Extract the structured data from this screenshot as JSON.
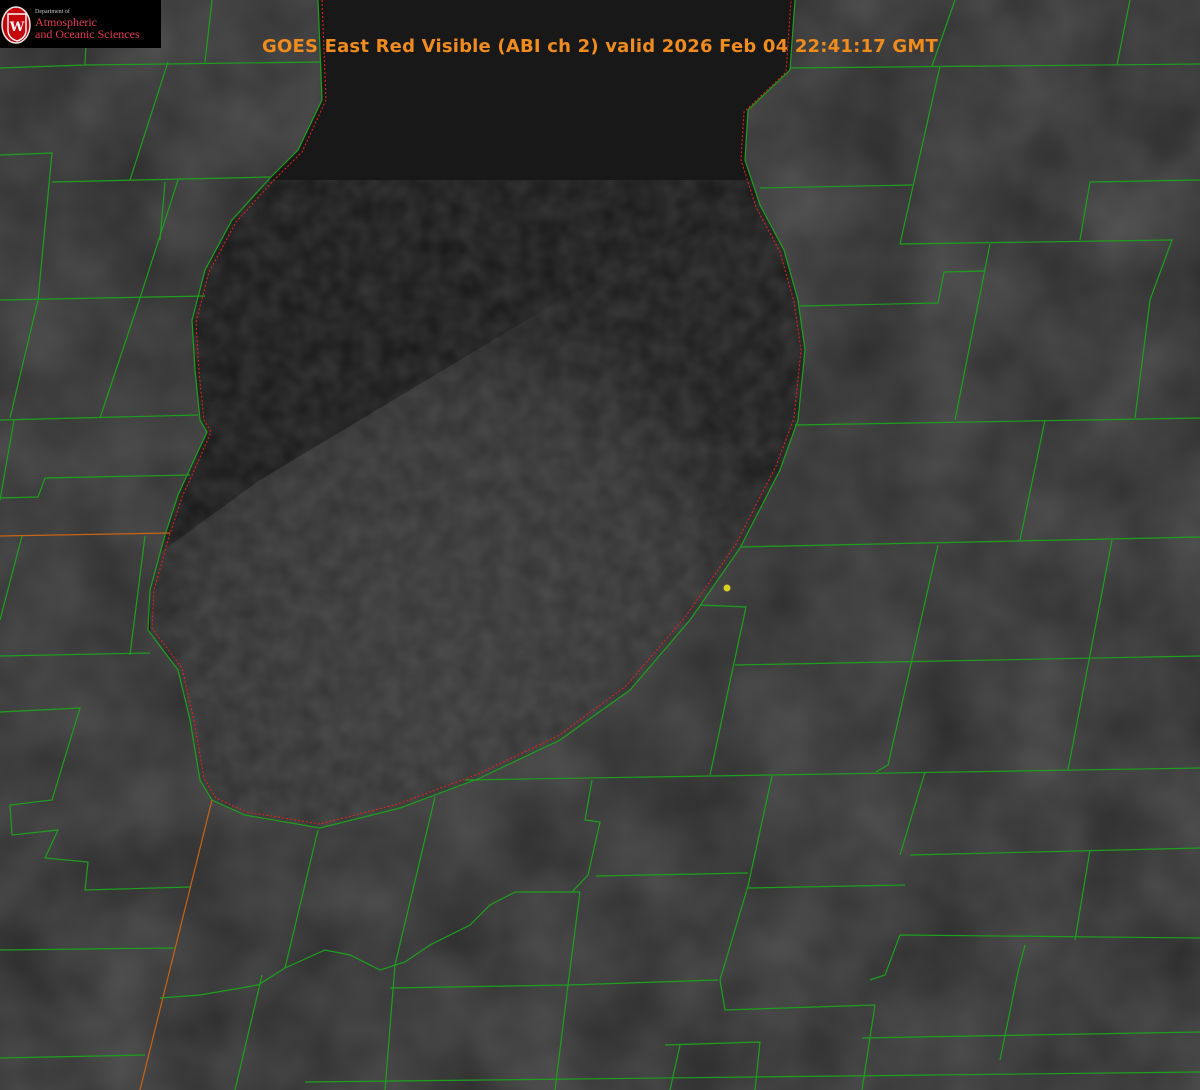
{
  "title": {
    "text": "GOES East Red Visible (ABI ch 2) valid 2026 Feb 04 22:41:17 GMT",
    "color": "#f08c1e"
  },
  "logo": {
    "department": "Department of",
    "line1": "Atmospheric",
    "line2": "and Oceanic Sciences",
    "shield_letter": "W",
    "accent_color": "#c5050c",
    "text_color": "#e43a4f"
  },
  "map": {
    "imagery": "GOES East Red Visible ABI channel 2",
    "background_land_color": "#2a2a2a",
    "lake_color": "#181818",
    "county_line_color": "#1ea01e",
    "state_line_color": "#c86414",
    "coastline_color": "#e02020",
    "station_marker_color": "#d8d020",
    "station_marker_icon": "location-dot-icon"
  }
}
